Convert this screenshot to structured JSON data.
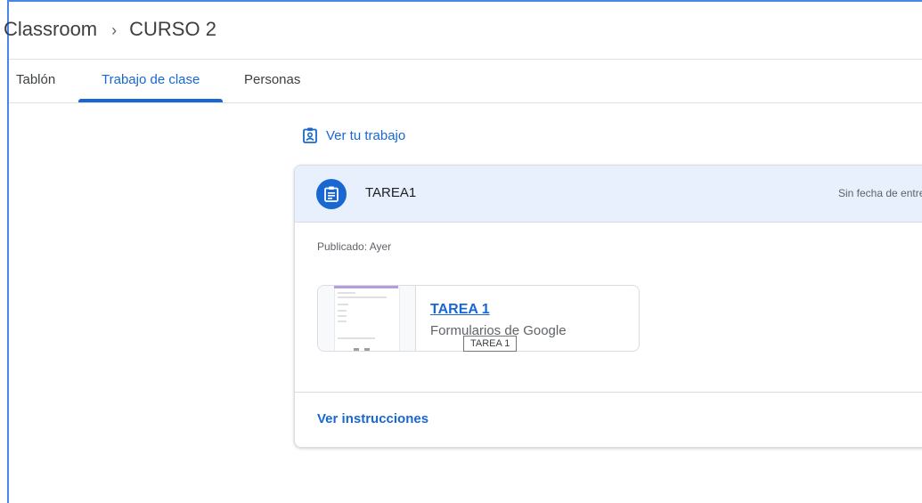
{
  "breadcrumb": {
    "root": "Classroom",
    "separator": "›",
    "course": "CURSO 2"
  },
  "tabs": [
    {
      "label": "Tablón"
    },
    {
      "label": "Trabajo de clase",
      "active": true
    },
    {
      "label": "Personas"
    }
  ],
  "view_work": {
    "label": "Ver tu trabajo",
    "icon": "assignment-ind-icon"
  },
  "assignment": {
    "title": "TAREA1",
    "due": "Sin fecha de entrega",
    "posted": "Publicado: Ayer",
    "icon": "assignment-icon",
    "attachment": {
      "title": "TAREA 1",
      "type": "Formularios de Google"
    },
    "tooltip": "TAREA 1",
    "instructions_link": "Ver instrucciones"
  },
  "colors": {
    "accent": "#1967d2",
    "header_bg": "#e8f0fe",
    "divider": "#e0e0e0",
    "frame": "#4a86e8"
  }
}
